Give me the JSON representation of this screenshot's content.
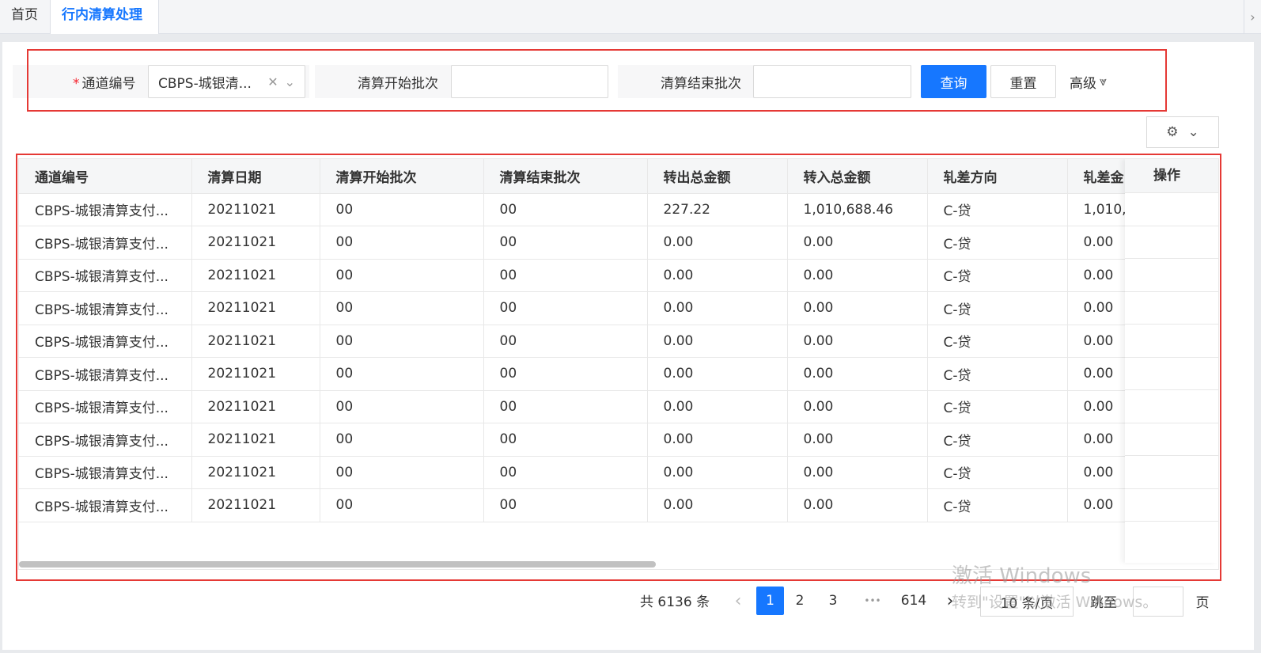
{
  "tabs": [
    {
      "label": "首页"
    },
    {
      "label": "行内清算处理"
    }
  ],
  "search": {
    "channel_label": "通道编号",
    "channel_value": "CBPS-城银清...",
    "start_batch_label": "清算开始批次",
    "start_batch_value": "",
    "end_batch_label": "清算结束批次",
    "end_batch_value": "",
    "query_label": "查询",
    "reset_label": "重置",
    "advanced_label": "高级"
  },
  "table": {
    "columns": [
      "通道编号",
      "清算日期",
      "清算开始批次",
      "清算结束批次",
      "转出总金额",
      "转入总金额",
      "轧差方向",
      "轧差金"
    ],
    "operation_label": "操作",
    "rows": [
      [
        "CBPS-城银清算支付...",
        "20211021",
        "00",
        "00",
        "227.22",
        "1,010,688.46",
        "C-贷",
        "1,010,"
      ],
      [
        "CBPS-城银清算支付...",
        "20211021",
        "00",
        "00",
        "0.00",
        "0.00",
        "C-贷",
        "0.00"
      ],
      [
        "CBPS-城银清算支付...",
        "20211021",
        "00",
        "00",
        "0.00",
        "0.00",
        "C-贷",
        "0.00"
      ],
      [
        "CBPS-城银清算支付...",
        "20211021",
        "00",
        "00",
        "0.00",
        "0.00",
        "C-贷",
        "0.00"
      ],
      [
        "CBPS-城银清算支付...",
        "20211021",
        "00",
        "00",
        "0.00",
        "0.00",
        "C-贷",
        "0.00"
      ],
      [
        "CBPS-城银清算支付...",
        "20211021",
        "00",
        "00",
        "0.00",
        "0.00",
        "C-贷",
        "0.00"
      ],
      [
        "CBPS-城银清算支付...",
        "20211021",
        "00",
        "00",
        "0.00",
        "0.00",
        "C-贷",
        "0.00"
      ],
      [
        "CBPS-城银清算支付...",
        "20211021",
        "00",
        "00",
        "0.00",
        "0.00",
        "C-贷",
        "0.00"
      ],
      [
        "CBPS-城银清算支付...",
        "20211021",
        "00",
        "00",
        "0.00",
        "0.00",
        "C-贷",
        "0.00"
      ],
      [
        "CBPS-城银清算支付...",
        "20211021",
        "00",
        "00",
        "0.00",
        "0.00",
        "C-贷",
        "0.00"
      ]
    ]
  },
  "pagination": {
    "total_text": "共 6136 条",
    "pages": [
      "1",
      "2",
      "3"
    ],
    "ellipsis": "•••",
    "last_page": "614",
    "current_page": "1",
    "page_size": "10 条/页",
    "jump_label": "跳至",
    "page_suffix": "页"
  },
  "watermark": {
    "line1": "激活 Windows",
    "line2": "转到\"设置\"以激活 Windows。"
  },
  "colors": {
    "primary": "#1677ff",
    "highlight_border": "#e53935"
  },
  "icons": [
    "clear-icon",
    "chevron-down-icon",
    "double-chevron-down-icon",
    "gear-icon",
    "chevron-left-icon",
    "chevron-right-icon",
    "chevron-right-scroll-icon"
  ]
}
